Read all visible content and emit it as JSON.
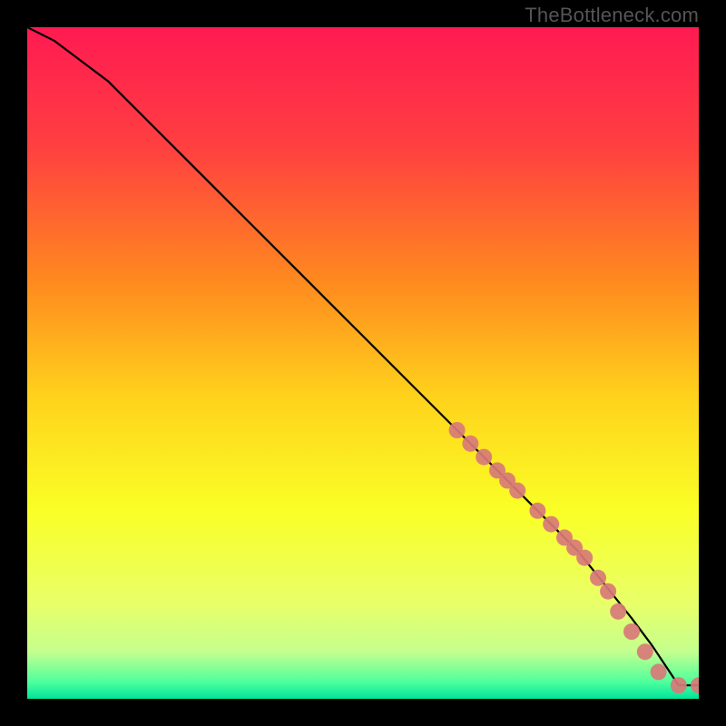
{
  "watermark": "TheBottleneck.com",
  "chart_data": {
    "type": "line",
    "title": "",
    "xlabel": "",
    "ylabel": "",
    "xlim": [
      0,
      100
    ],
    "ylim": [
      0,
      100
    ],
    "grid": false,
    "legend": false,
    "gradient_stops": [
      {
        "offset": 0,
        "color": "#ff1a52"
      },
      {
        "offset": 0.18,
        "color": "#ff4040"
      },
      {
        "offset": 0.38,
        "color": "#ff8a1f"
      },
      {
        "offset": 0.55,
        "color": "#ffd21c"
      },
      {
        "offset": 0.72,
        "color": "#faff26"
      },
      {
        "offset": 0.86,
        "color": "#e8ff6a"
      },
      {
        "offset": 0.93,
        "color": "#c4ff8e"
      },
      {
        "offset": 0.975,
        "color": "#4eff9d"
      },
      {
        "offset": 1.0,
        "color": "#00e59a"
      }
    ],
    "series": [
      {
        "name": "curve",
        "type": "line",
        "x": [
          0,
          4,
          8,
          12,
          18,
          26,
          34,
          42,
          50,
          58,
          64,
          70,
          76,
          82,
          86,
          90,
          93,
          95,
          97,
          100
        ],
        "y": [
          100,
          98,
          95,
          92,
          86,
          78,
          70,
          62,
          54,
          46,
          40,
          34,
          28,
          22,
          17,
          12,
          8,
          5,
          2,
          2
        ]
      },
      {
        "name": "markers",
        "type": "scatter",
        "marker_color": "#d87a78",
        "marker_radius": 9,
        "x": [
          64,
          66,
          68,
          70,
          71.5,
          73,
          76,
          78,
          80,
          81.5,
          83,
          85,
          86.5,
          88,
          90,
          92,
          94,
          97,
          100
        ],
        "y": [
          40,
          38,
          36,
          34,
          32.5,
          31,
          28,
          26,
          24,
          22.5,
          21,
          18,
          16,
          13,
          10,
          7,
          4,
          2,
          2
        ]
      }
    ]
  }
}
